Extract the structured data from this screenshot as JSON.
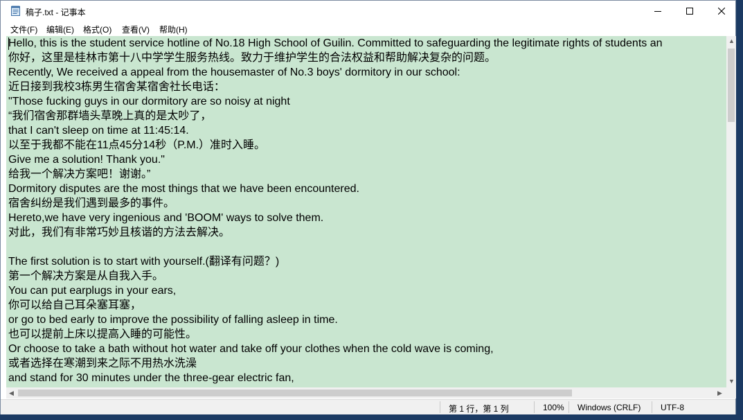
{
  "window": {
    "title": "稿子.txt - 记事本",
    "controls": {
      "minimize_icon": "minimize-icon",
      "maximize_icon": "maximize-icon",
      "close_icon": "close-icon"
    }
  },
  "menu": {
    "items": [
      {
        "label": "文件(F)"
      },
      {
        "label": "编辑(E)"
      },
      {
        "label": "格式(O)"
      },
      {
        "label": "查看(V)"
      },
      {
        "label": "帮助(H)"
      }
    ]
  },
  "editor": {
    "background": "#c9e6d0",
    "lines": [
      "Hello, this is the student service hotline of No.18 High School of Guilin. Committed to safeguarding the legitimate rights of students an",
      "你好，这里是桂林市第十八中学学生服务热线。致力于维护学生的合法权益和帮助解决复杂的问题。",
      "Recently, We received a appeal from the housemaster of No.3 boys' dormitory in our school:",
      "近日接到我校3栋男生宿舍某宿舍社长电话：",
      "\"Those fucking guys in our dormitory are so noisy at night",
      "“我们宿舍那群墙头草晚上真的是太吵了，",
      "that I can't sleep on time at 11:45:14.",
      "以至于我都不能在11点45分14秒（P.M.）准时入睡。",
      "Give me a solution! Thank you.\"",
      "给我一个解决方案吧！谢谢。”",
      "Dormitory disputes are the most things that we have been encountered.",
      "宿舍纠纷是我们遇到最多的事件。",
      "Hereto,we have very ingenious and 'BOOM' ways to solve them.",
      "对此，我们有非常巧妙且核谐的方法去解决。",
      "",
      "The first solution is to start with yourself.(翻译有问题？)",
      "第一个解决方案是从自我入手。",
      "You can put earplugs in your ears,",
      "你可以给自己耳朵塞耳塞，",
      "or go to bed early to improve the possibility of falling asleep in time.",
      "也可以提前上床以提高入睡的可能性。",
      "Or choose to take a bath without hot water and take off your clothes when the cold wave is coming,",
      "或者选择在寒潮到来之际不用热水洗澡",
      "and stand for 30 minutes under the three-gear electric fan,"
    ]
  },
  "statusbar": {
    "position": "第 1 行，第 1 列",
    "zoom": "100%",
    "line_ending": "Windows (CRLF)",
    "encoding": "UTF-8"
  }
}
